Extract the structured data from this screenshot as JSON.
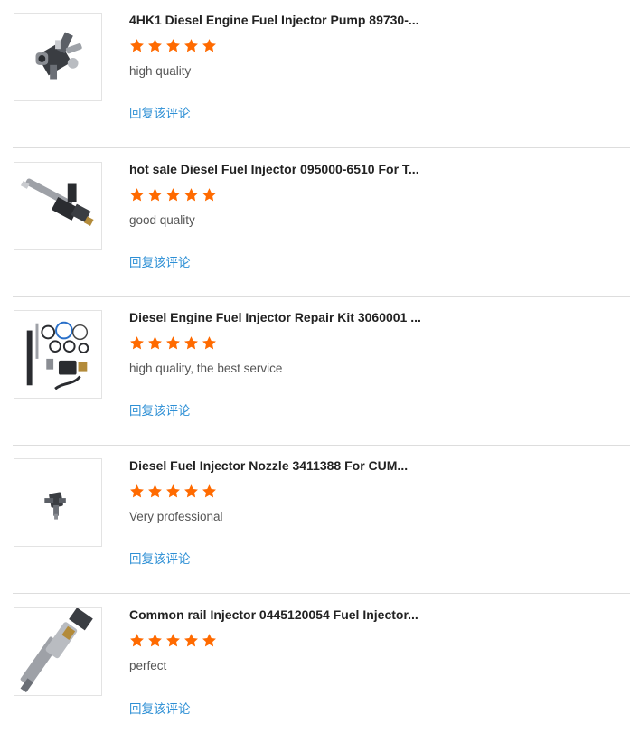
{
  "colors": {
    "star": "#ff6a00",
    "reply_link": "#2d8fd5",
    "divider": "#dddddd"
  },
  "reviews": [
    {
      "title": "4HK1 Diesel Engine Fuel Injector Pump 89730-...",
      "rating": 5,
      "comment": "high quality",
      "reply_label": "回复该评论",
      "image_icon": "fuel-pump-product-image"
    },
    {
      "title": "hot sale Diesel Fuel Injector 095000-6510 For T...",
      "rating": 5,
      "comment": "good quality",
      "reply_label": "回复该评论",
      "image_icon": "fuel-injector-product-image"
    },
    {
      "title": "Diesel Engine Fuel Injector Repair Kit 3060001 ...",
      "rating": 5,
      "comment": "high quality, the best service",
      "reply_label": "回复该评论",
      "image_icon": "repair-kit-product-image"
    },
    {
      "title": "Diesel Fuel Injector Nozzle 3411388 For CUM...",
      "rating": 5,
      "comment": "Very professional",
      "reply_label": "回复该评论",
      "image_icon": "nozzle-product-image"
    },
    {
      "title": "Common rail Injector 0445120054 Fuel Injector...",
      "rating": 5,
      "comment": "perfect",
      "reply_label": "回复该评论",
      "image_icon": "common-rail-injector-product-image"
    }
  ]
}
